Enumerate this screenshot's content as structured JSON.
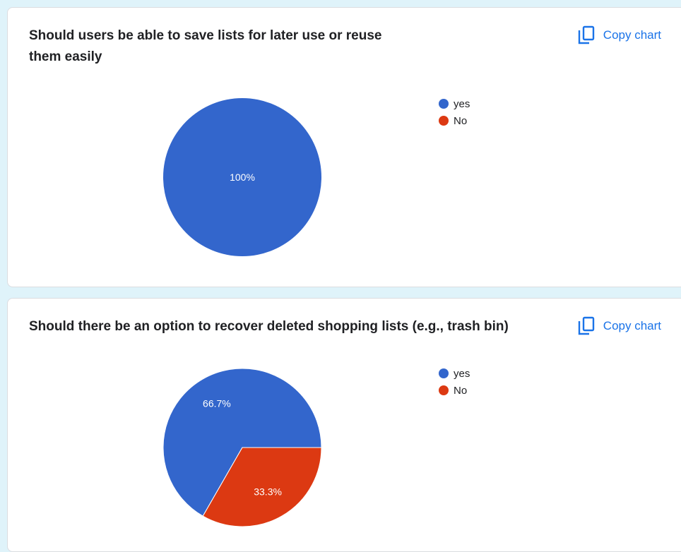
{
  "colors": {
    "page_background": "#dff3fa",
    "card_background": "#ffffff",
    "accent": "#1a73e8",
    "series_yes": "#3366cc",
    "series_no": "#dc3912"
  },
  "copy_label": "Copy chart",
  "copy_icon": "copy-icon",
  "legend": [
    {
      "label": "yes",
      "color": "#3366cc"
    },
    {
      "label": "No",
      "color": "#dc3912"
    }
  ],
  "questions": [
    {
      "title": "Should users be able to save lists for later use or reuse them easily",
      "slice_labels": {
        "yes": "100%",
        "no": ""
      }
    },
    {
      "title": "Should there be an option to recover deleted shopping lists (e.g., trash bin)",
      "slice_labels": {
        "yes": "66.7%",
        "no": "33.3%"
      }
    }
  ],
  "chart_data": [
    {
      "type": "pie",
      "title": "Should users be able to save lists for later use or reuse them easily",
      "categories": [
        "yes",
        "No"
      ],
      "values": [
        100,
        0
      ],
      "colors": [
        "#3366cc",
        "#dc3912"
      ],
      "legend_position": "right"
    },
    {
      "type": "pie",
      "title": "Should there be an option to recover deleted shopping lists (e.g., trash bin)",
      "categories": [
        "yes",
        "No"
      ],
      "values": [
        66.7,
        33.3
      ],
      "colors": [
        "#3366cc",
        "#dc3912"
      ],
      "legend_position": "right"
    }
  ]
}
